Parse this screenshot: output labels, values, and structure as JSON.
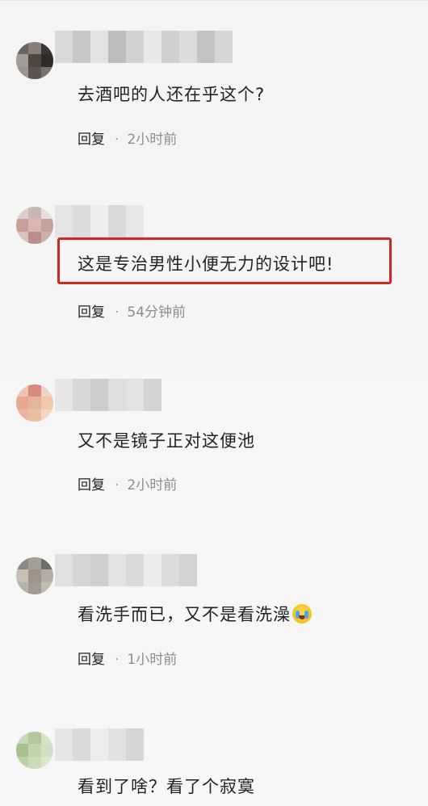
{
  "comments": [
    {
      "text": "去酒吧的人还在乎这个?",
      "reply_label": "回复",
      "separator": "·",
      "time": "2小时前",
      "avatar_icon": "blurred-avatar-icon",
      "avatar_colors": [
        "#6b6460",
        "#8a7f78",
        "#3a3532",
        "#a49c96",
        "#4e4641",
        "#2f2b29",
        "#9d9590",
        "#5c5450",
        "#7a726e"
      ],
      "name_colors": [
        "#d9d9d9",
        "#c8c8c8",
        "#e2e2e2",
        "#bdbdbd",
        "#d1d1d1",
        "#e8e8e8",
        "#cfcfcf",
        "#dcdcdc",
        "#c4c4c4",
        "#d6d6d6"
      ]
    },
    {
      "text": "这是专治男性小便无力的设计吧!",
      "reply_label": "回复",
      "separator": "·",
      "time": "54分钟前",
      "highlighted": true,
      "highlight_color": "#d6241f",
      "avatar_icon": "blurred-avatar-icon",
      "avatar_colors": [
        "#d9cfcb",
        "#c9b8b2",
        "#e6e0dd",
        "#c79f98",
        "#d8b7b0",
        "#c3a29c",
        "#d6c4bf",
        "#b98e87",
        "#cdb0aa"
      ],
      "name_colors": [
        "#e4e4e4",
        "#dddddd",
        "#eeeeee",
        "#d9d9d9",
        "#e8e8e8"
      ]
    },
    {
      "text": "又不是镜子正对这便池",
      "reply_label": "回复",
      "separator": "·",
      "time": "2小时前",
      "avatar_icon": "blurred-avatar-icon",
      "avatar_colors": [
        "#e9c5ba",
        "#d98a7c",
        "#f0d3c6",
        "#e7a892",
        "#e6b49c",
        "#f2c7a8",
        "#ecb2a2",
        "#e9c09e",
        "#f1d6c6"
      ],
      "name_colors": [
        "#e6e6e6",
        "#d8d8d8",
        "#cccccc",
        "#dedede",
        "#e3e3e3",
        "#d4d4d4"
      ]
    },
    {
      "text": "看洗手而已，又不是看洗澡",
      "reply_label": "回复",
      "separator": "·",
      "time": "1小时前",
      "emoji_icon": "crying-laughing-emoji-icon",
      "avatar_icon": "blurred-avatar-icon",
      "avatar_colors": [
        "#8a8a85",
        "#a49e97",
        "#6f6b66",
        "#c7bfb5",
        "#9e9489",
        "#b5ada3",
        "#b8b2ab",
        "#a09a93",
        "#c2bbb3"
      ],
      "name_colors": [
        "#e0e0e0",
        "#d6d6d6",
        "#cfcfcf",
        "#e3e3e3",
        "#d9d9d9",
        "#ececec",
        "#dcdcdc",
        "#d2d2d2"
      ]
    },
    {
      "text": "看到了啥？看了个寂寞",
      "avatar_icon": "blurred-avatar-icon",
      "avatar_colors": [
        "#c9d8b8",
        "#b3c79c",
        "#d7e3c9",
        "#a8bf8f",
        "#c2d4ad",
        "#d2dfc2",
        "#bccfa6",
        "#cbdab9",
        "#dde7d0"
      ],
      "name_colors": [
        "#e6e6e6",
        "#dadada",
        "#ededed",
        "#e1e1e1",
        "#d6d6d6"
      ]
    }
  ]
}
